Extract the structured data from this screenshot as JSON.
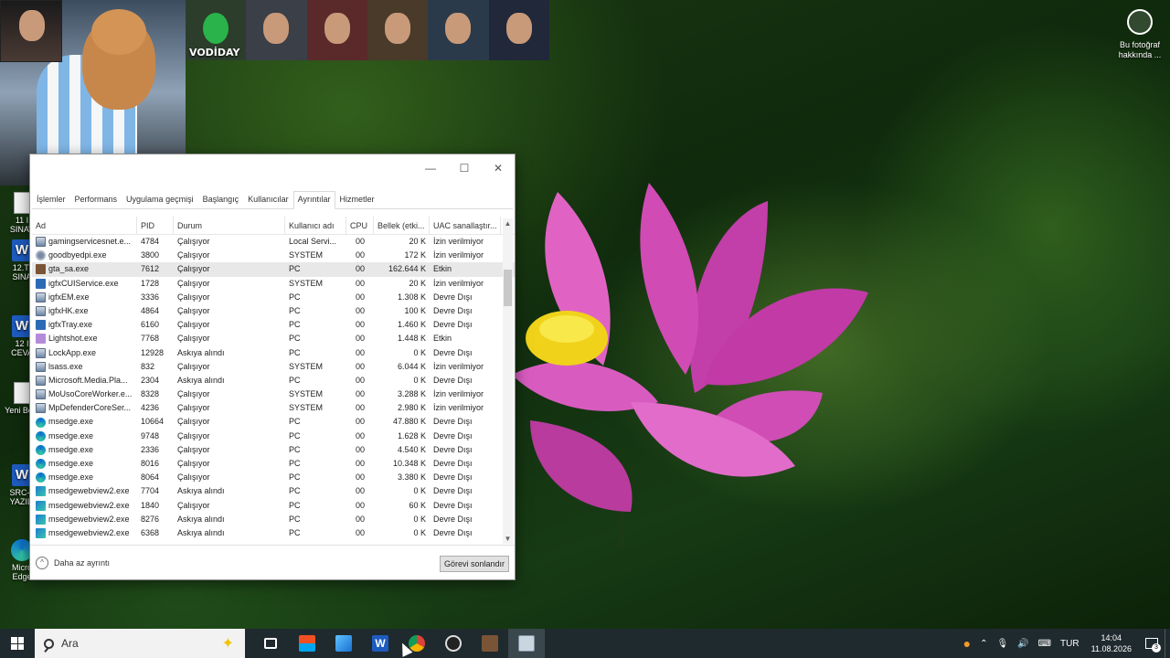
{
  "desktop": {
    "icons": [
      {
        "label": "11 I SINAV",
        "kind": "doc"
      },
      {
        "label": "12.TI SINA",
        "kind": "word"
      },
      {
        "label": "12 I CEVA",
        "kind": "word"
      },
      {
        "label": "Yeni Belg",
        "kind": "doc"
      },
      {
        "label": "SRC-1 YAZILI",
        "kind": "word"
      },
      {
        "label": "Micro Edge",
        "kind": "edge"
      }
    ],
    "bing": {
      "label": "Bu fotoğraf hakkında ..."
    }
  },
  "overlay": {
    "tile_label": "VODİDAY"
  },
  "task_manager": {
    "tabs": [
      "İşlemler",
      "Performans",
      "Uygulama geçmişi",
      "Başlangıç",
      "Kullanıcılar",
      "Ayrıntılar",
      "Hizmetler"
    ],
    "active_tab": "Ayrıntılar",
    "columns": [
      "Ad",
      "PID",
      "Durum",
      "Kullanıcı adı",
      "CPU",
      "Bellek (etki...",
      "UAC sanallaştır..."
    ],
    "rows": [
      {
        "name": "gamingservicesnet.e...",
        "pid": "4784",
        "status": "Çalışıyor",
        "user": "Local Servi...",
        "cpu": "00",
        "mem": "20 K",
        "uac": "İzin verilmiyor",
        "icon": "win"
      },
      {
        "name": "goodbyedpi.exe",
        "pid": "3800",
        "status": "Çalışıyor",
        "user": "SYSTEM",
        "cpu": "00",
        "mem": "172 K",
        "uac": "İzin verilmiyor",
        "icon": "gear"
      },
      {
        "name": "gta_sa.exe",
        "pid": "7612",
        "status": "Çalışıyor",
        "user": "PC",
        "cpu": "00",
        "mem": "162.644 K",
        "uac": "Etkin",
        "icon": "gta",
        "selected": true
      },
      {
        "name": "igfxCUIService.exe",
        "pid": "1728",
        "status": "Çalışıyor",
        "user": "SYSTEM",
        "cpu": "00",
        "mem": "20 K",
        "uac": "İzin verilmiyor",
        "icon": "intel"
      },
      {
        "name": "igfxEM.exe",
        "pid": "3336",
        "status": "Çalışıyor",
        "user": "PC",
        "cpu": "00",
        "mem": "1.308 K",
        "uac": "Devre Dışı",
        "icon": "win"
      },
      {
        "name": "igfxHK.exe",
        "pid": "4864",
        "status": "Çalışıyor",
        "user": "PC",
        "cpu": "00",
        "mem": "100 K",
        "uac": "Devre Dışı",
        "icon": "win"
      },
      {
        "name": "igfxTray.exe",
        "pid": "6160",
        "status": "Çalışıyor",
        "user": "PC",
        "cpu": "00",
        "mem": "1.460 K",
        "uac": "Devre Dışı",
        "icon": "intel"
      },
      {
        "name": "Lightshot.exe",
        "pid": "7768",
        "status": "Çalışıyor",
        "user": "PC",
        "cpu": "00",
        "mem": "1.448 K",
        "uac": "Etkin",
        "icon": "light"
      },
      {
        "name": "LockApp.exe",
        "pid": "12928",
        "status": "Askıya alındı",
        "user": "PC",
        "cpu": "00",
        "mem": "0 K",
        "uac": "Devre Dışı",
        "icon": "win"
      },
      {
        "name": "lsass.exe",
        "pid": "832",
        "status": "Çalışıyor",
        "user": "SYSTEM",
        "cpu": "00",
        "mem": "6.044 K",
        "uac": "İzin verilmiyor",
        "icon": "win"
      },
      {
        "name": "Microsoft.Media.Pla...",
        "pid": "2304",
        "status": "Askıya alındı",
        "user": "PC",
        "cpu": "00",
        "mem": "0 K",
        "uac": "Devre Dışı",
        "icon": "win"
      },
      {
        "name": "MoUsoCoreWorker.e...",
        "pid": "8328",
        "status": "Çalışıyor",
        "user": "SYSTEM",
        "cpu": "00",
        "mem": "3.288 K",
        "uac": "İzin verilmiyor",
        "icon": "win"
      },
      {
        "name": "MpDefenderCoreSer...",
        "pid": "4236",
        "status": "Çalışıyor",
        "user": "SYSTEM",
        "cpu": "00",
        "mem": "2.980 K",
        "uac": "İzin verilmiyor",
        "icon": "win"
      },
      {
        "name": "msedge.exe",
        "pid": "10664",
        "status": "Çalışıyor",
        "user": "PC",
        "cpu": "00",
        "mem": "47.880 K",
        "uac": "Devre Dışı",
        "icon": "edge"
      },
      {
        "name": "msedge.exe",
        "pid": "9748",
        "status": "Çalışıyor",
        "user": "PC",
        "cpu": "00",
        "mem": "1.628 K",
        "uac": "Devre Dışı",
        "icon": "edge"
      },
      {
        "name": "msedge.exe",
        "pid": "2336",
        "status": "Çalışıyor",
        "user": "PC",
        "cpu": "00",
        "mem": "4.540 K",
        "uac": "Devre Dışı",
        "icon": "edge"
      },
      {
        "name": "msedge.exe",
        "pid": "8016",
        "status": "Çalışıyor",
        "user": "PC",
        "cpu": "00",
        "mem": "10.348 K",
        "uac": "Devre Dışı",
        "icon": "edge"
      },
      {
        "name": "msedge.exe",
        "pid": "8064",
        "status": "Çalışıyor",
        "user": "PC",
        "cpu": "00",
        "mem": "3.380 K",
        "uac": "Devre Dışı",
        "icon": "edge"
      },
      {
        "name": "msedgewebview2.exe",
        "pid": "7704",
        "status": "Askıya alındı",
        "user": "PC",
        "cpu": "00",
        "mem": "0 K",
        "uac": "Devre Dışı",
        "icon": "ewv"
      },
      {
        "name": "msedgewebview2.exe",
        "pid": "1840",
        "status": "Çalışıyor",
        "user": "PC",
        "cpu": "00",
        "mem": "60 K",
        "uac": "Devre Dışı",
        "icon": "ewv"
      },
      {
        "name": "msedgewebview2.exe",
        "pid": "8276",
        "status": "Askıya alındı",
        "user": "PC",
        "cpu": "00",
        "mem": "0 K",
        "uac": "Devre Dışı",
        "icon": "ewv"
      },
      {
        "name": "msedgewebview2.exe",
        "pid": "6368",
        "status": "Askıya alındı",
        "user": "PC",
        "cpu": "00",
        "mem": "0 K",
        "uac": "Devre Dışı",
        "icon": "ewv"
      }
    ],
    "footer": {
      "less_details": "Daha az ayrıntı",
      "end_task": "Görevi sonlandır"
    }
  },
  "taskbar": {
    "search_placeholder": "Ara",
    "apps": [
      "task-view",
      "store",
      "photos",
      "word",
      "chrome",
      "gta-launcher",
      "gta-sa",
      "task-manager"
    ],
    "active_app": "task-manager",
    "tray": {
      "language": "TUR",
      "time": "14:04",
      "date": "11.08.2026",
      "notification_count": "3"
    }
  }
}
